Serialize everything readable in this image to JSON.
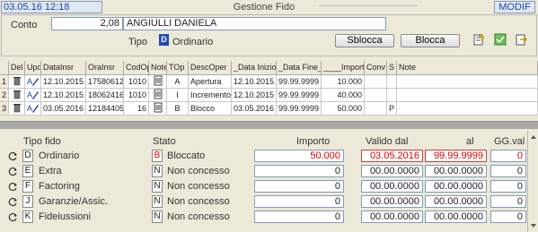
{
  "topbar": {
    "timestamp": "03.05.16 12:18",
    "title": "Gestione Fido",
    "mode": "MODIF"
  },
  "header": {
    "conto_label": "Conto",
    "conto_number": "2,08",
    "conto_name": "ANGIULLI DANIELA",
    "tipo_label": "Tipo",
    "tipo_code": "D",
    "tipo_value": "Ordinario",
    "sblocca_label": "Sblocca",
    "blocca_label": "Blocca",
    "icons": [
      "edit-note-icon",
      "check-icon",
      "export-icon"
    ]
  },
  "grid": {
    "columns": [
      "Del",
      "Upd",
      "DataInsr",
      "OraInsr",
      "CodOp",
      "Note",
      "TOp",
      "DescOper",
      "_Data Inizio_",
      "_Data Fine_",
      "____Importo",
      "Conv",
      "S",
      "Note"
    ],
    "rows": [
      {
        "num": "1",
        "data_insr": "12.10.2015",
        "ora_insr": "17580612",
        "cod_op": "1010",
        "top": "A",
        "desc": "Apertura",
        "data_inizio": "12.10.2015",
        "data_fine": "99.99.9999",
        "importo": "10.000",
        "conv": "",
        "s": "",
        "note": ""
      },
      {
        "num": "2",
        "data_insr": "12.10.2015",
        "ora_insr": "18062416",
        "cod_op": "1010",
        "top": "I",
        "desc": "Incremento",
        "data_inizio": "12.10.2015",
        "data_fine": "99.99.9999",
        "importo": "40.000",
        "conv": "",
        "s": "",
        "note": ""
      },
      {
        "num": "3",
        "data_insr": "03.05.2016",
        "ora_insr": "12184405",
        "cod_op": "16",
        "top": "B",
        "desc": "Blocco",
        "data_inizio": "03.05.2016",
        "data_fine": "99.99.9999",
        "importo": "50.000",
        "conv": "",
        "s": "P",
        "note": ""
      }
    ]
  },
  "fido": {
    "headers": {
      "tipo": "Tipo fido",
      "stato": "Stato",
      "importo": "Importo",
      "valido_dal": "Valido dal",
      "al": "al",
      "gg_val": "GG.val"
    },
    "rows": [
      {
        "code": "D",
        "name": "Ordinario",
        "stato_code": "B",
        "stato": "Bloccato",
        "importo": "50.000",
        "dal": "03.05.2016",
        "al": "99.99.9999",
        "gg": "0",
        "highlight": true
      },
      {
        "code": "E",
        "name": "Extra",
        "stato_code": "N",
        "stato": "Non concesso",
        "importo": "0",
        "dal": "00.00.0000",
        "al": "00.00.0000",
        "gg": "0",
        "highlight": false
      },
      {
        "code": "F",
        "name": "Factoring",
        "stato_code": "N",
        "stato": "Non concesso",
        "importo": "0",
        "dal": "00.00.0000",
        "al": "00.00.0000",
        "gg": "0",
        "highlight": false
      },
      {
        "code": "J",
        "name": "Garanzie/Assic.",
        "stato_code": "N",
        "stato": "Non concesso",
        "importo": "0",
        "dal": "00.00.0000",
        "al": "00.00.0000",
        "gg": "0",
        "highlight": false
      },
      {
        "code": "K",
        "name": "Fideiussioni",
        "stato_code": "N",
        "stato": "Non concesso",
        "importo": "0",
        "dal": "00.00.0000",
        "al": "00.00.0000",
        "gg": "0",
        "highlight": false
      }
    ]
  },
  "colors": {
    "accent_blue": "#1a47a8",
    "alert_red": "#e00000",
    "background": "#ece9d8"
  }
}
